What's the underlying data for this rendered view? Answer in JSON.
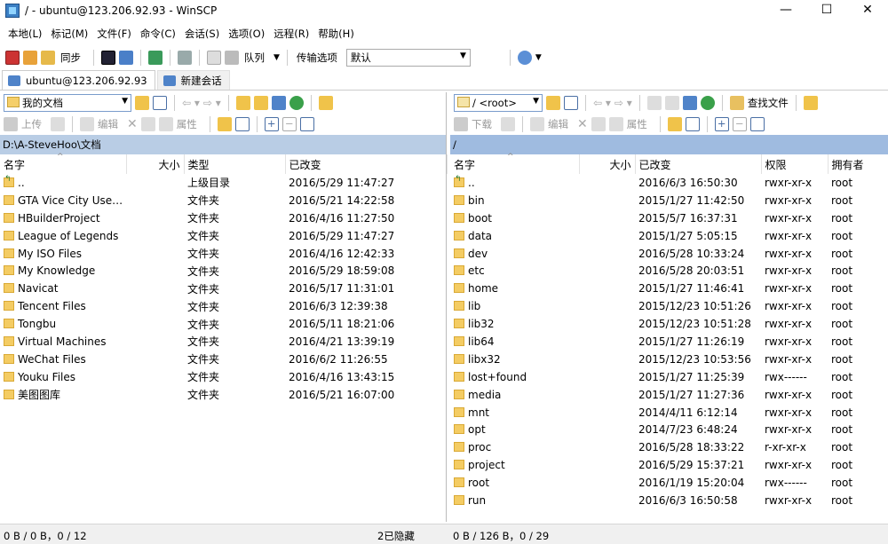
{
  "window": {
    "title": "/ - ubuntu@123.206.92.93 - WinSCP",
    "minimize": "—",
    "maximize": "☐",
    "close": "✕"
  },
  "menu": [
    "本地(L)",
    "标记(M)",
    "文件(F)",
    "命令(C)",
    "会话(S)",
    "选项(O)",
    "远程(R)",
    "帮助(H)"
  ],
  "toolbar": {
    "sync_label": "同步",
    "queue_label": "队列",
    "transfer_label": "传输选项",
    "transfer_value": "默认"
  },
  "tabs": [
    {
      "label": "ubuntu@123.206.92.93"
    },
    {
      "label": "新建会话"
    }
  ],
  "left": {
    "location": "我的文档",
    "actions": {
      "upload": "上传",
      "edit": "编辑",
      "props": "属性"
    },
    "path": "D:\\A-SteveHoo\\文档",
    "columns": [
      "名字",
      "大小",
      "类型",
      "已改变"
    ],
    "rows": [
      {
        "name": "..",
        "size": "",
        "type": "上级目录",
        "changed": "2016/5/29  11:47:27",
        "up": true
      },
      {
        "name": "GTA Vice City User ...",
        "size": "",
        "type": "文件夹",
        "changed": "2016/5/21  14:22:58"
      },
      {
        "name": "HBuilderProject",
        "size": "",
        "type": "文件夹",
        "changed": "2016/4/16  11:27:50"
      },
      {
        "name": "League of Legends",
        "size": "",
        "type": "文件夹",
        "changed": "2016/5/29  11:47:27"
      },
      {
        "name": "My ISO Files",
        "size": "",
        "type": "文件夹",
        "changed": "2016/4/16  12:42:33"
      },
      {
        "name": "My Knowledge",
        "size": "",
        "type": "文件夹",
        "changed": "2016/5/29  18:59:08"
      },
      {
        "name": "Navicat",
        "size": "",
        "type": "文件夹",
        "changed": "2016/5/17  11:31:01"
      },
      {
        "name": "Tencent Files",
        "size": "",
        "type": "文件夹",
        "changed": "2016/6/3  12:39:38"
      },
      {
        "name": "Tongbu",
        "size": "",
        "type": "文件夹",
        "changed": "2016/5/11  18:21:06"
      },
      {
        "name": "Virtual Machines",
        "size": "",
        "type": "文件夹",
        "changed": "2016/4/21  13:39:19"
      },
      {
        "name": "WeChat Files",
        "size": "",
        "type": "文件夹",
        "changed": "2016/6/2  11:26:55"
      },
      {
        "name": "Youku Files",
        "size": "",
        "type": "文件夹",
        "changed": "2016/4/16  13:43:15"
      },
      {
        "name": "美图图库",
        "size": "",
        "type": "文件夹",
        "changed": "2016/5/21  16:07:00"
      }
    ],
    "status": "0 B / 0 B，0 / 12",
    "hidden": "2已隐藏"
  },
  "right": {
    "location": "/ <root>",
    "find_label": "查找文件",
    "actions": {
      "download": "下载",
      "edit": "编辑",
      "props": "属性"
    },
    "path": "/",
    "columns": [
      "名字",
      "大小",
      "已改变",
      "权限",
      "拥有者"
    ],
    "rows": [
      {
        "name": "..",
        "changed": "2016/6/3 16:50:30",
        "perm": "rwxr-xr-x",
        "owner": "root",
        "up": true
      },
      {
        "name": "bin",
        "changed": "2015/1/27 11:42:50",
        "perm": "rwxr-xr-x",
        "owner": "root"
      },
      {
        "name": "boot",
        "changed": "2015/5/7 16:37:31",
        "perm": "rwxr-xr-x",
        "owner": "root"
      },
      {
        "name": "data",
        "changed": "2015/1/27 5:05:15",
        "perm": "rwxr-xr-x",
        "owner": "root"
      },
      {
        "name": "dev",
        "changed": "2016/5/28 10:33:24",
        "perm": "rwxr-xr-x",
        "owner": "root"
      },
      {
        "name": "etc",
        "changed": "2016/5/28 20:03:51",
        "perm": "rwxr-xr-x",
        "owner": "root"
      },
      {
        "name": "home",
        "changed": "2015/1/27 11:46:41",
        "perm": "rwxr-xr-x",
        "owner": "root"
      },
      {
        "name": "lib",
        "changed": "2015/12/23 10:51:26",
        "perm": "rwxr-xr-x",
        "owner": "root"
      },
      {
        "name": "lib32",
        "changed": "2015/12/23 10:51:28",
        "perm": "rwxr-xr-x",
        "owner": "root"
      },
      {
        "name": "lib64",
        "changed": "2015/1/27 11:26:19",
        "perm": "rwxr-xr-x",
        "owner": "root"
      },
      {
        "name": "libx32",
        "changed": "2015/12/23 10:53:56",
        "perm": "rwxr-xr-x",
        "owner": "root"
      },
      {
        "name": "lost+found",
        "changed": "2015/1/27 11:25:39",
        "perm": "rwx------",
        "owner": "root"
      },
      {
        "name": "media",
        "changed": "2015/1/27 11:27:36",
        "perm": "rwxr-xr-x",
        "owner": "root"
      },
      {
        "name": "mnt",
        "changed": "2014/4/11 6:12:14",
        "perm": "rwxr-xr-x",
        "owner": "root"
      },
      {
        "name": "opt",
        "changed": "2014/7/23 6:48:24",
        "perm": "rwxr-xr-x",
        "owner": "root"
      },
      {
        "name": "proc",
        "changed": "2016/5/28 18:33:22",
        "perm": "r-xr-xr-x",
        "owner": "root"
      },
      {
        "name": "project",
        "changed": "2016/5/29 15:37:21",
        "perm": "rwxr-xr-x",
        "owner": "root"
      },
      {
        "name": "root",
        "changed": "2016/1/19 15:20:04",
        "perm": "rwx------",
        "owner": "root"
      },
      {
        "name": "run",
        "changed": "2016/6/3 16:50:58",
        "perm": "rwxr-xr-x",
        "owner": "root"
      }
    ],
    "status": "0 B / 126 B，0 / 29"
  }
}
